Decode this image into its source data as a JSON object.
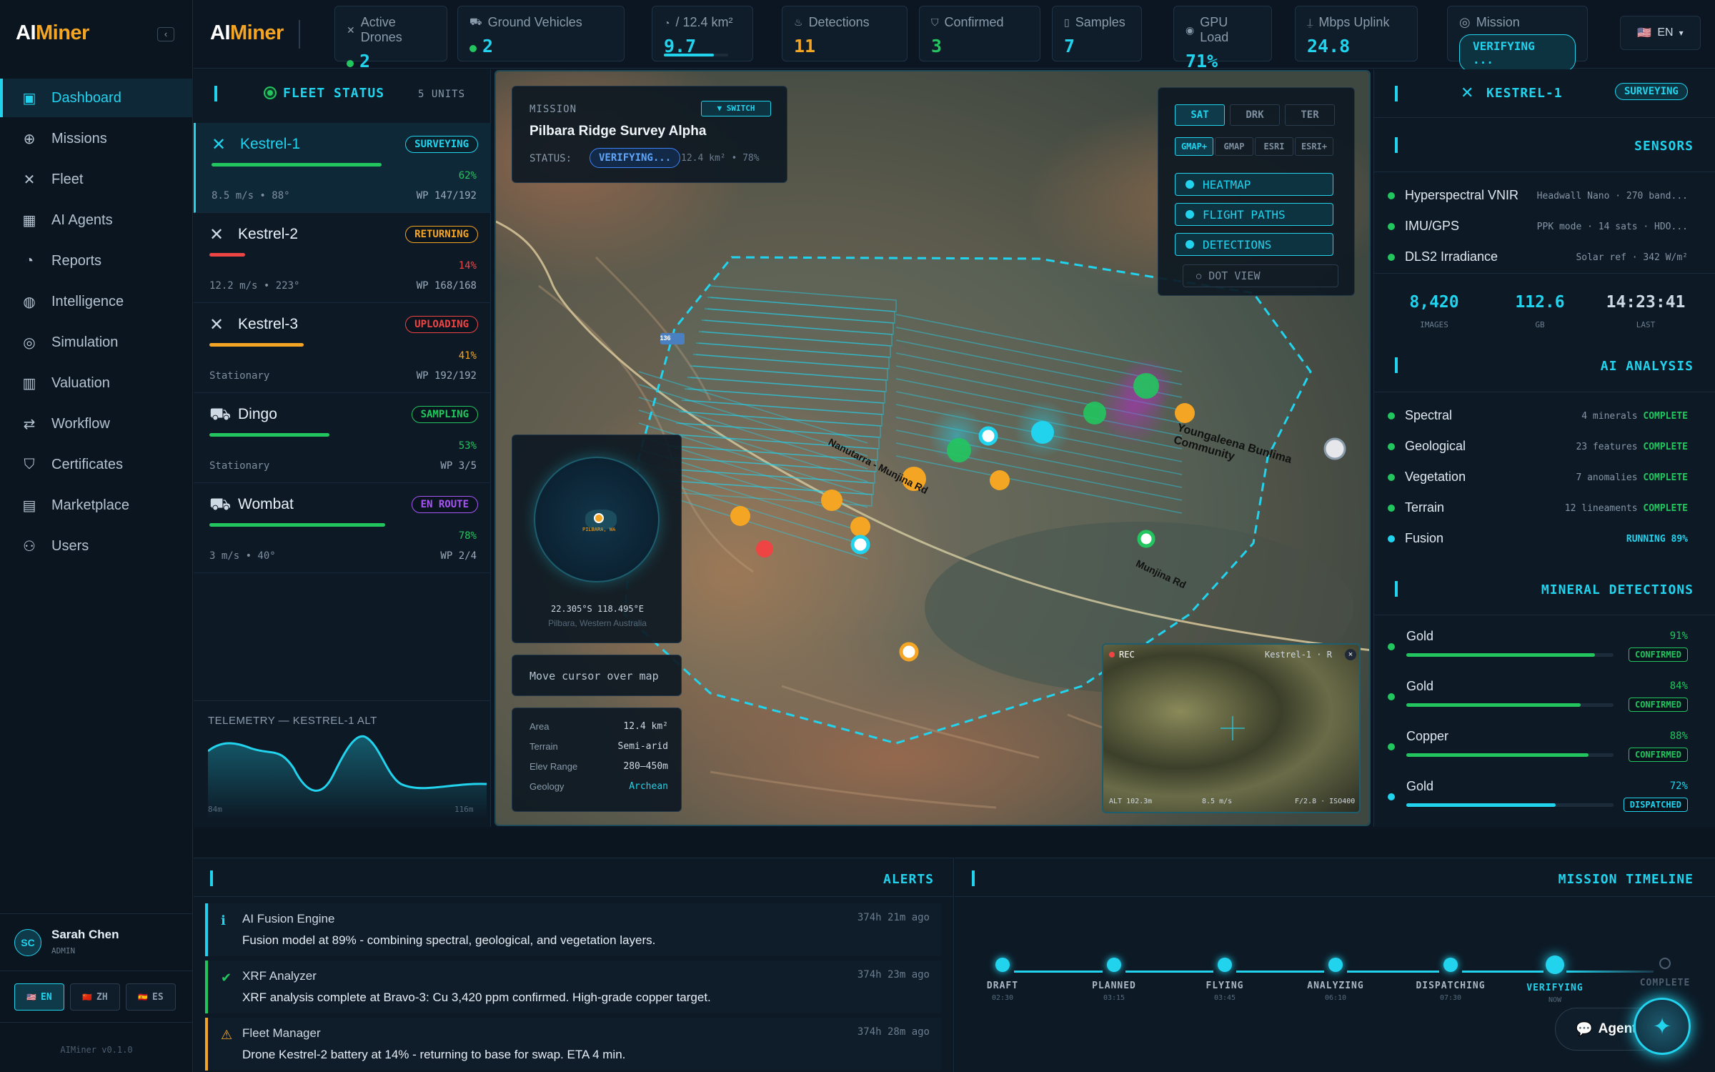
{
  "app": {
    "logo_ai": "AI",
    "logo_miner": "Miner",
    "collapse": "‹",
    "version": "AIMiner v0.1.0"
  },
  "nav": {
    "items": [
      {
        "label": "Dashboard",
        "icon": "dashboard-icon"
      },
      {
        "label": "Missions",
        "icon": "crosshair-icon"
      },
      {
        "label": "Fleet",
        "icon": "drone-icon"
      },
      {
        "label": "AI Agents",
        "icon": "chip-icon"
      },
      {
        "label": "Reports",
        "icon": "gauge-icon"
      },
      {
        "label": "Intelligence",
        "icon": "globe-icon"
      },
      {
        "label": "Simulation",
        "icon": "target-icon"
      },
      {
        "label": "Valuation",
        "icon": "bar-chart-icon"
      },
      {
        "label": "Workflow",
        "icon": "flow-icon"
      },
      {
        "label": "Certificates",
        "icon": "shield-icon"
      },
      {
        "label": "Marketplace",
        "icon": "store-icon"
      },
      {
        "label": "Users",
        "icon": "users-icon"
      }
    ]
  },
  "user": {
    "initials": "SC",
    "name": "Sarah Chen",
    "role": "ADMIN"
  },
  "languages": [
    {
      "label": "EN",
      "flag": "🇺🇸"
    },
    {
      "label": "ZH",
      "flag": "🇨🇳"
    },
    {
      "label": "ES",
      "flag": "🇪🇸"
    }
  ],
  "topbar": {
    "stats": [
      {
        "label": "Active Drones",
        "value": "2",
        "dot": true,
        "color": "#22d3ee"
      },
      {
        "label": "Ground Vehicles",
        "value": "2",
        "dot": true,
        "color": "#22d3ee"
      },
      {
        "label": "/ 12.4 km²",
        "value": "9.7",
        "color": "#22d3ee"
      },
      {
        "label": "Detections",
        "value": "11",
        "color": "#f5a524"
      },
      {
        "label": "Confirmed",
        "value": "3",
        "color": "#22c55e"
      },
      {
        "label": "Samples",
        "value": "7",
        "color": "#22d3ee"
      },
      {
        "label": "GPU Load",
        "value": "71%",
        "color": "#22d3ee"
      },
      {
        "label": "Mbps Uplink",
        "value": "24.8",
        "color": "#22d3ee"
      }
    ],
    "coverage_progress": 0.78,
    "mission_label": "Mission",
    "mission_status": "VERIFYING ...",
    "lang": "EN",
    "lang_flag": "🇺🇸"
  },
  "fleet": {
    "title": "FLEET STATUS",
    "count": "5 UNITS",
    "units": [
      {
        "name": "Kestrel-1",
        "status": "SURVEYING",
        "pct": "62%",
        "progress": 0.62,
        "meta": "8.5 m/s • 88°",
        "wp": "WP 147/192",
        "color": "#22c55e",
        "badge": "#22d3ee"
      },
      {
        "name": "Kestrel-2",
        "status": "RETURNING",
        "pct": "14%",
        "progress": 0.14,
        "meta": "12.2 m/s • 223°",
        "wp": "WP 168/168",
        "color": "#ef4444",
        "badge": "#f5a524"
      },
      {
        "name": "Kestrel-3",
        "status": "UPLOADING",
        "pct": "41%",
        "progress": 0.41,
        "meta": "Stationary",
        "wp": "WP 192/192",
        "color": "#f5a524",
        "badge": "#ef4444"
      },
      {
        "name": "Dingo",
        "status": "SAMPLING",
        "pct": "53%",
        "progress": 0.53,
        "meta": "Stationary",
        "wp": "WP 3/5",
        "color": "#22c55e",
        "badge": "#22c55e"
      },
      {
        "name": "Wombat",
        "status": "EN ROUTE",
        "pct": "78%",
        "progress": 0.78,
        "meta": "3 m/s • 40°",
        "wp": "WP 2/4",
        "color": "#22c55e",
        "badge": "#a855f7"
      }
    ]
  },
  "telemetry": {
    "title": "TELEMETRY — KESTREL-1 ALT",
    "min": "84m",
    "max": "116m"
  },
  "mission_card": {
    "label": "MISSION",
    "switch": "▼ SWITCH",
    "name": "Pilbara Ridge Survey Alpha",
    "status_label": "STATUS:",
    "status": "VERIFYING...",
    "meta": "12.4 km² • 78%"
  },
  "map": {
    "layers_top": [
      "SAT",
      "DRK",
      "TER"
    ],
    "layers_src": [
      "GMAP+",
      "GMAP",
      "ESRI",
      "ESRI+"
    ],
    "toggles": [
      "HEATMAP",
      "FLIGHT PATHS",
      "DETECTIONS"
    ],
    "dot_view": "DOT VIEW",
    "road1": "Nanutarra - Munjina Rd",
    "road2": "Munjina Rd",
    "place": "Youngaleena Bunlima Community",
    "shield": "136",
    "globe_caption": "PILBARA, WA",
    "coords": "22.305°S 118.495°E",
    "region": "Pilbara, Western Australia",
    "cursor_hint": "Move cursor over map",
    "info": [
      {
        "k": "Area",
        "v": "12.4 km²"
      },
      {
        "k": "Terrain",
        "v": "Semi-arid"
      },
      {
        "k": "Elev Range",
        "v": "280–450m"
      },
      {
        "k": "Geology",
        "v": "Archean"
      }
    ],
    "feed": {
      "rec": "REC",
      "drone": "Kestrel-1 · R",
      "alt": "ALT 102.3m",
      "speed": "8.5 m/s",
      "lens": "F/2.8 · ISO400"
    }
  },
  "right": {
    "unit": "KESTREL-1",
    "unit_status": "SURVEYING",
    "sensors_title": "SENSORS",
    "sensors": [
      {
        "name": "Hyperspectral VNIR",
        "detail": "Headwall Nano · 270 band..."
      },
      {
        "name": "IMU/GPS",
        "detail": "PPK mode · 14 sats · HDO..."
      },
      {
        "name": "DLS2 Irradiance",
        "detail": "Solar ref · 342 W/m²"
      }
    ],
    "stats": [
      {
        "value": "8,420",
        "label": "IMAGES"
      },
      {
        "value": "112.6",
        "label": "GB"
      },
      {
        "value": "14:23:41",
        "label": "LAST"
      }
    ],
    "ai_title": "AI ANALYSIS",
    "analysis": [
      {
        "name": "Spectral",
        "detail": "4 minerals",
        "state": "COMPLETE",
        "color": "#22c55e"
      },
      {
        "name": "Geological",
        "detail": "23 features",
        "state": "COMPLETE",
        "color": "#22c55e"
      },
      {
        "name": "Vegetation",
        "detail": "7 anomalies",
        "state": "COMPLETE",
        "color": "#22c55e"
      },
      {
        "name": "Terrain",
        "detail": "12 lineaments",
        "state": "COMPLETE",
        "color": "#22c55e"
      },
      {
        "name": "Fusion",
        "detail": "",
        "state": "RUNNING 89%",
        "color": "#22d3ee"
      }
    ],
    "mineral_title": "MINERAL DETECTIONS",
    "minerals": [
      {
        "name": "Gold",
        "pct": "91%",
        "value": 0.91,
        "state": "CONFIRMED",
        "color": "#22c55e"
      },
      {
        "name": "Gold",
        "pct": "84%",
        "value": 0.84,
        "state": "CONFIRMED",
        "color": "#22c55e"
      },
      {
        "name": "Copper",
        "pct": "88%",
        "value": 0.88,
        "state": "CONFIRMED",
        "color": "#22c55e"
      },
      {
        "name": "Gold",
        "pct": "72%",
        "value": 0.72,
        "state": "DISPATCHED",
        "color": "#22d3ee"
      }
    ]
  },
  "alerts": {
    "title": "ALERTS",
    "items": [
      {
        "source": "AI Fusion Engine",
        "message": "Fusion model at 89% - combining spectral, geological, and vegetation layers.",
        "time": "374h 21m ago",
        "color": "#22d3ee",
        "icon": "ℹ"
      },
      {
        "source": "XRF Analyzer",
        "message": "XRF analysis complete at Bravo-3: Cu 3,420 ppm confirmed. High-grade copper target.",
        "time": "374h 23m ago",
        "color": "#22c55e",
        "icon": "✔"
      },
      {
        "source": "Fleet Manager",
        "message": "Drone Kestrel-2 battery at 14% - returning to base for swap. ETA 4 min.",
        "time": "374h 28m ago",
        "color": "#f5a524",
        "icon": "⚠"
      }
    ]
  },
  "timeline": {
    "title": "MISSION TIMELINE",
    "steps": [
      {
        "label": "DRAFT",
        "time": "02:30"
      },
      {
        "label": "PLANNED",
        "time": "03:15"
      },
      {
        "label": "FLYING",
        "time": "03:45"
      },
      {
        "label": "ANALYZING",
        "time": "06:10"
      },
      {
        "label": "DISPATCHING",
        "time": "07:30"
      },
      {
        "label": "VERIFYING",
        "time": "NOW"
      },
      {
        "label": "COMPLETE",
        "time": ""
      }
    ]
  },
  "agent_button": "Agent"
}
